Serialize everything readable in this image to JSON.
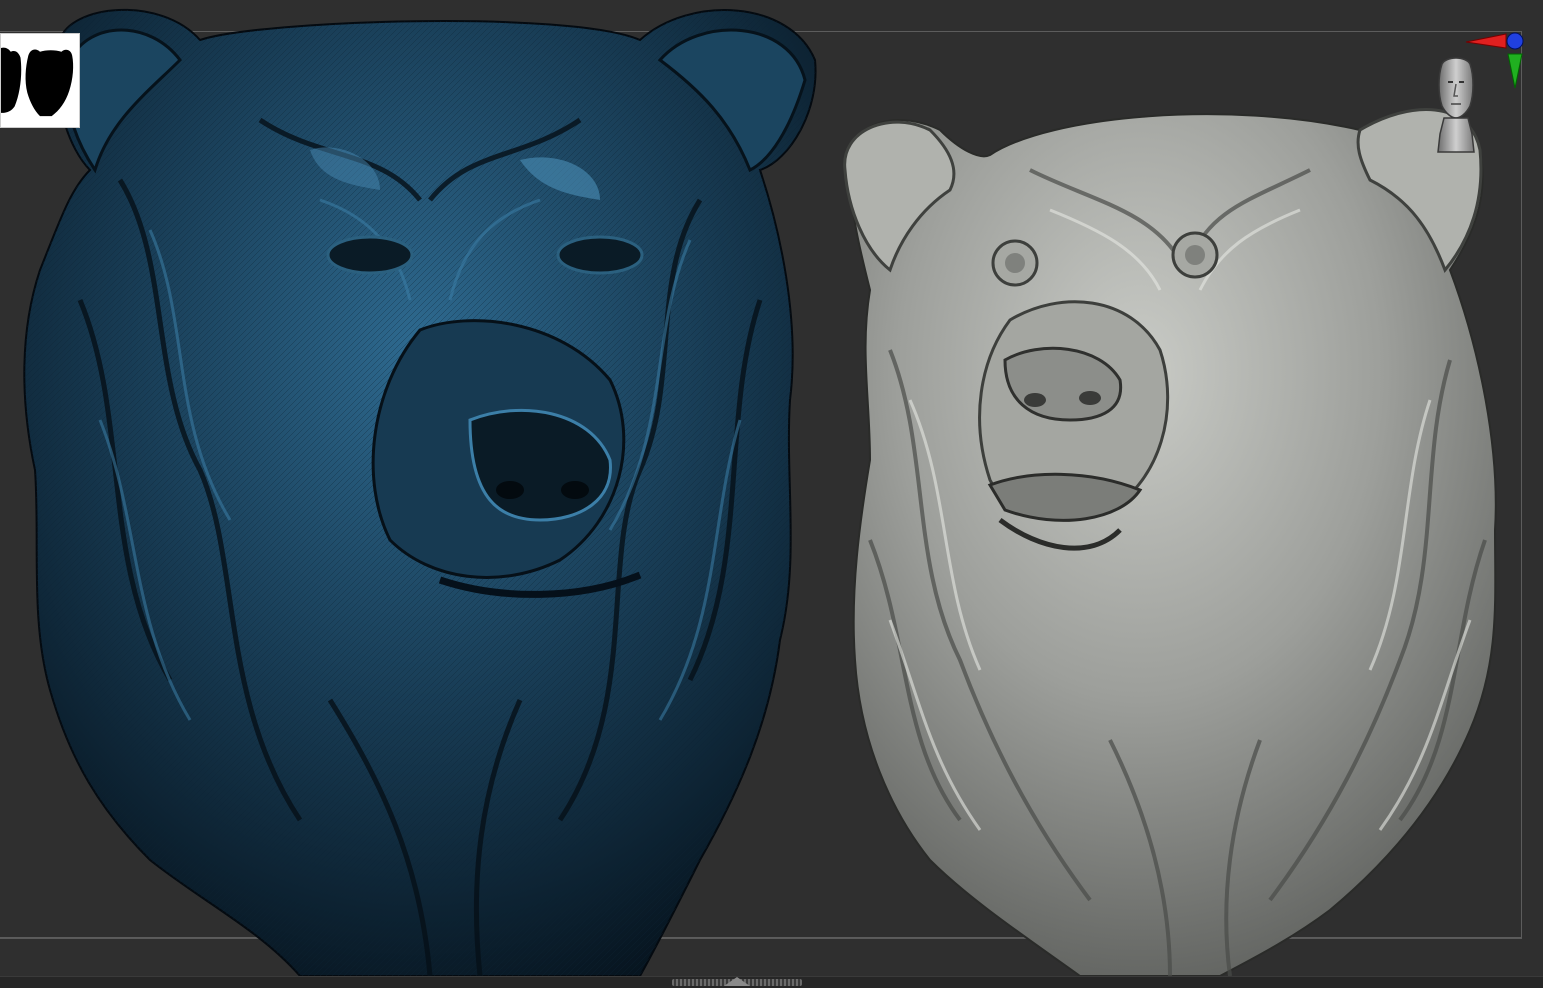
{
  "viewport": {
    "background_color": "#2f2f2f",
    "frame_color": "#5c5c5c"
  },
  "models": [
    {
      "name": "bear-bust-wireframe",
      "material_color": "#1f4a66",
      "highlight_color": "#4b8fb8",
      "shadow_color": "#07131c"
    },
    {
      "name": "bear-bust-clay",
      "material_color": "#9a9c98",
      "highlight_color": "#d9dbd6",
      "shadow_color": "#3e403d"
    }
  ],
  "icons": {
    "thumbnail": "bear-silhouette-thumbnail-icon",
    "gizmo": "xyz-axis-gizmo-icon",
    "navigation": "head-navigation-icon",
    "tray_handle": "tray-resize-handle-icon",
    "tray_arrow": "tray-expand-arrow-icon"
  },
  "axis_colors": {
    "x": "#e02020",
    "y": "#20b020",
    "z": "#2040e0"
  }
}
